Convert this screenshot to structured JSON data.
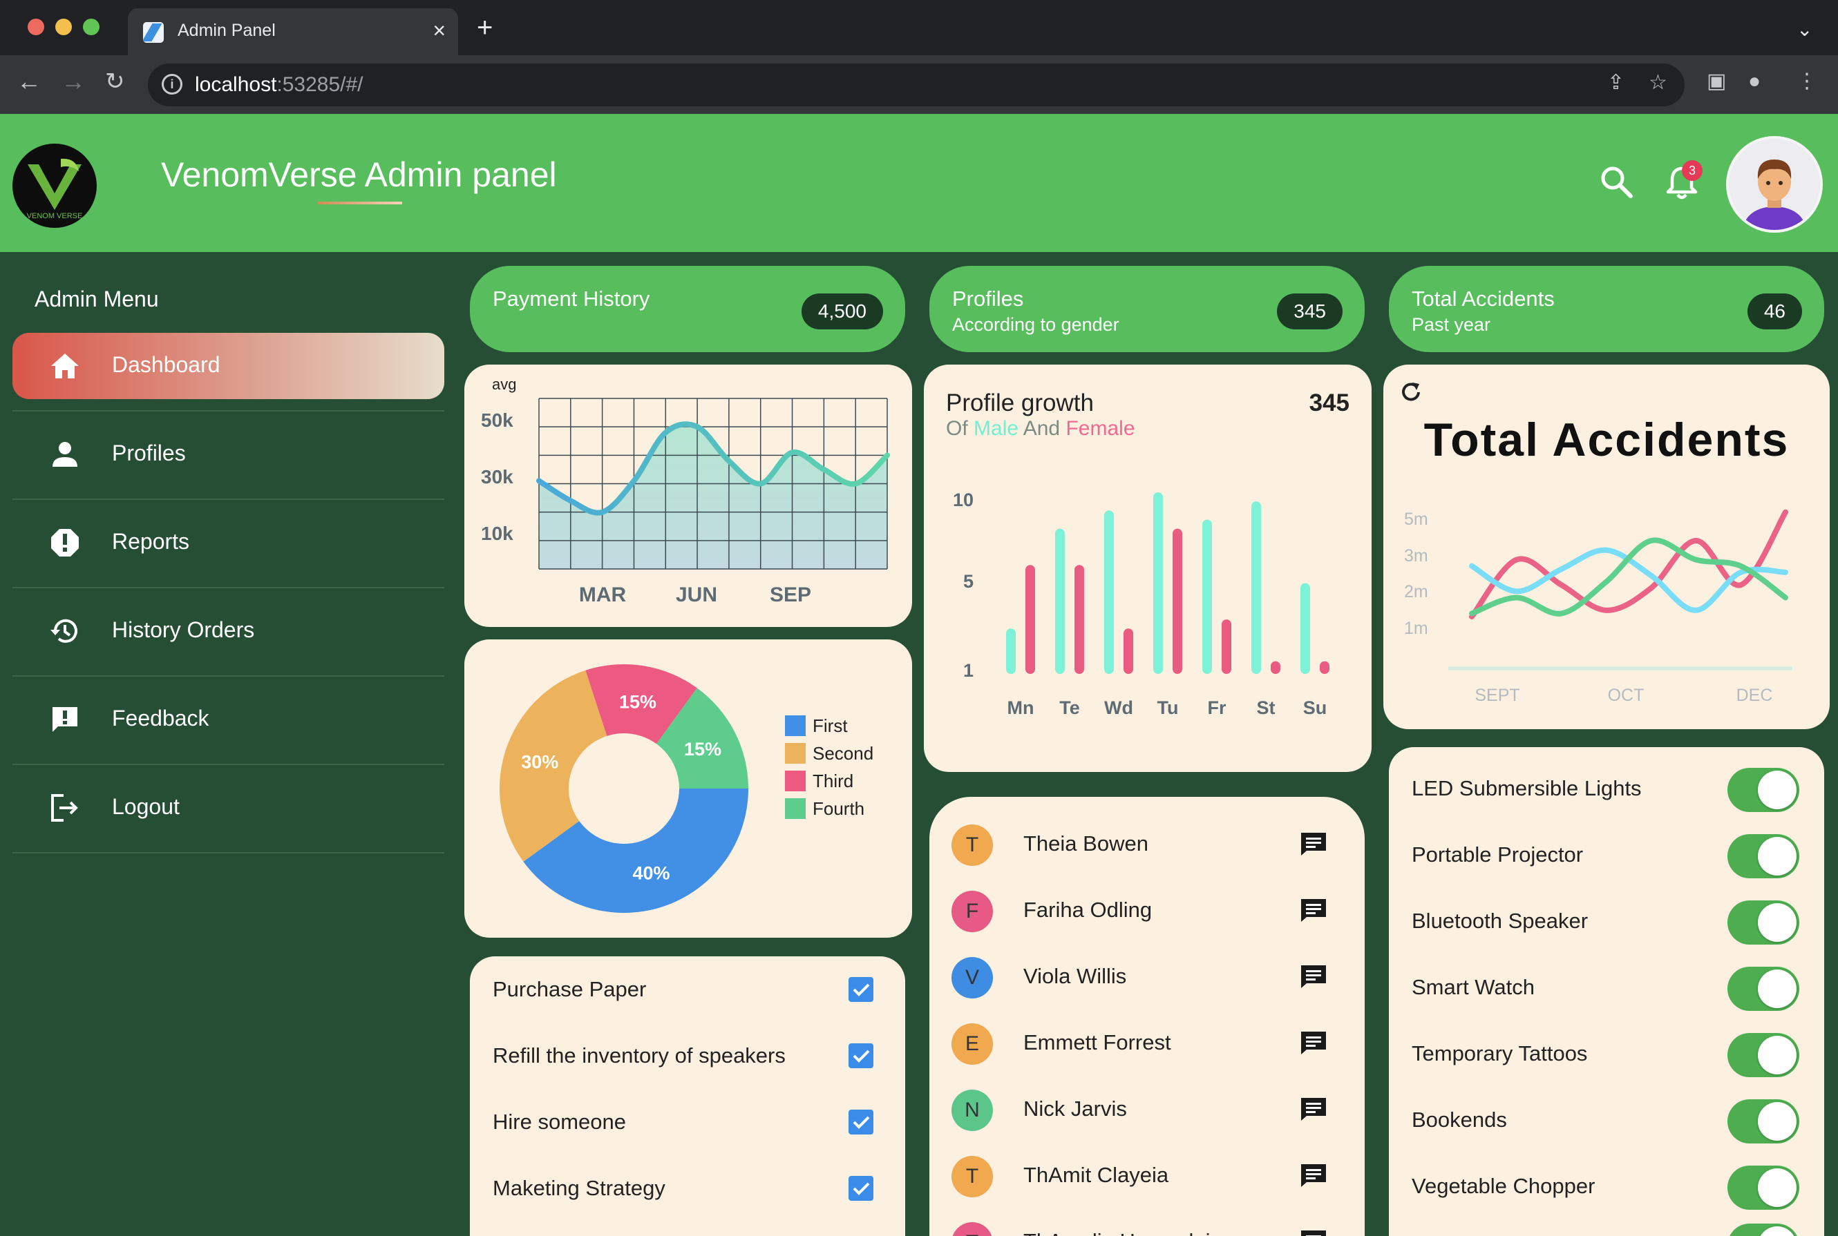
{
  "browser": {
    "tab_title": "Admin Panel",
    "url_host": "localhost",
    "url_rest": ":53285/#/"
  },
  "header": {
    "title": "VenomVerse Admin panel",
    "notification_count": "3",
    "logo_text": "VENOM VERSE"
  },
  "sidebar": {
    "title": "Admin Menu",
    "items": [
      {
        "label": "Dashboard",
        "icon": "home-icon",
        "active": true
      },
      {
        "label": "Profiles",
        "icon": "person-icon"
      },
      {
        "label": "Reports",
        "icon": "alert-icon"
      },
      {
        "label": "History Orders",
        "icon": "history-icon"
      },
      {
        "label": "Feedback",
        "icon": "feedback-icon"
      },
      {
        "label": "Logout",
        "icon": "logout-icon"
      }
    ]
  },
  "stats": [
    {
      "title": "Payment History",
      "subtitle": "",
      "count": "4,500"
    },
    {
      "title": "Profiles",
      "subtitle": "According to gender",
      "count": "345"
    },
    {
      "title": "Total Accidents",
      "subtitle": "Past year",
      "count": "46"
    }
  ],
  "profile_growth": {
    "title": "Profile growth",
    "sub_of": "Of",
    "sub_male": "Male",
    "sub_and": "And",
    "sub_female": "Female",
    "count": "345"
  },
  "total_accidents_card": {
    "title": "Total Accidents"
  },
  "todos": [
    {
      "label": "Purchase Paper",
      "checked": true
    },
    {
      "label": "Refill the inventory of speakers",
      "checked": true
    },
    {
      "label": "Hire someone",
      "checked": true
    },
    {
      "label": "Maketing Strategy",
      "checked": true
    }
  ],
  "people": [
    {
      "initial": "T",
      "name": "Theia Bowen",
      "color": "#f0a94e"
    },
    {
      "initial": "F",
      "name": "Fariha Odling",
      "color": "#e85a86"
    },
    {
      "initial": "V",
      "name": "Viola Willis",
      "color": "#3e8de3"
    },
    {
      "initial": "E",
      "name": "Emmett Forrest",
      "color": "#f0a94e"
    },
    {
      "initial": "N",
      "name": "Nick Jarvis",
      "color": "#5cc68a"
    },
    {
      "initial": "T",
      "name": "ThAmit Clayeia",
      "color": "#f0a94e"
    },
    {
      "initial": "T",
      "name": "ThAmalie Howardeia",
      "color": "#e85a86"
    }
  ],
  "products": [
    {
      "name": "LED Submersible Lights",
      "on": true
    },
    {
      "name": "Portable Projector",
      "on": true
    },
    {
      "name": "Bluetooth Speaker",
      "on": true
    },
    {
      "name": "Smart Watch",
      "on": true
    },
    {
      "name": "Temporary Tattoos",
      "on": true
    },
    {
      "name": "Bookends",
      "on": true
    },
    {
      "name": "Vegetable Chopper",
      "on": true
    }
  ],
  "chart_data": [
    {
      "type": "area",
      "ylabel": "avg",
      "yticks": [
        "50k",
        "30k",
        "10k"
      ],
      "xticks": [
        "MAR",
        "JUN",
        "SEP"
      ],
      "ylim": [
        0,
        60
      ],
      "x": [
        0,
        1,
        2,
        3,
        4,
        5,
        6,
        7,
        8,
        9,
        10,
        11
      ],
      "values": [
        31,
        24,
        20,
        31,
        48,
        50,
        38,
        30,
        41,
        35,
        30,
        40
      ],
      "grid": true,
      "color": "#55c2b5"
    },
    {
      "type": "pie",
      "donut": true,
      "labels": [
        "First",
        "Second",
        "Third",
        "Fourth"
      ],
      "values": [
        40,
        30,
        15,
        15
      ],
      "value_labels": [
        "40%",
        "30%",
        "15%",
        "15%"
      ],
      "colors": [
        "#4290e5",
        "#ecb35c",
        "#ec5a82",
        "#5ecc8c"
      ],
      "legend": "right"
    },
    {
      "type": "bar",
      "categories": [
        "Mn",
        "Te",
        "Wd",
        "Tu",
        "Fr",
        "St",
        "Su"
      ],
      "yticks": [
        "10",
        "5",
        "1"
      ],
      "ylim": [
        0,
        11
      ],
      "series": [
        {
          "values": [
            2.5,
            8,
            9,
            10,
            8.5,
            9.5,
            5
          ],
          "color": "#7ef2d8"
        },
        {
          "values": [
            6,
            6,
            2.5,
            8,
            3,
            0.7,
            0.7
          ],
          "color": "#e95b80"
        }
      ]
    },
    {
      "type": "line",
      "yticks": [
        "5m",
        "3m",
        "2m",
        "1m"
      ],
      "xticks": [
        "SEPT",
        "OCT",
        "DEC"
      ],
      "ylim": [
        0,
        6
      ],
      "series": [
        {
          "values": [
            1.2,
            3.0,
            2.2,
            1.4,
            2.1,
            3.6,
            2.2,
            4.5
          ],
          "color": "#ea6286"
        },
        {
          "values": [
            2.8,
            2.0,
            2.7,
            3.3,
            2.5,
            1.4,
            2.6,
            2.6
          ],
          "color": "#79ddf7"
        },
        {
          "values": [
            1.3,
            1.8,
            1.3,
            2.3,
            3.6,
            3.0,
            2.8,
            1.8
          ],
          "color": "#5fcf8e"
        }
      ]
    }
  ]
}
